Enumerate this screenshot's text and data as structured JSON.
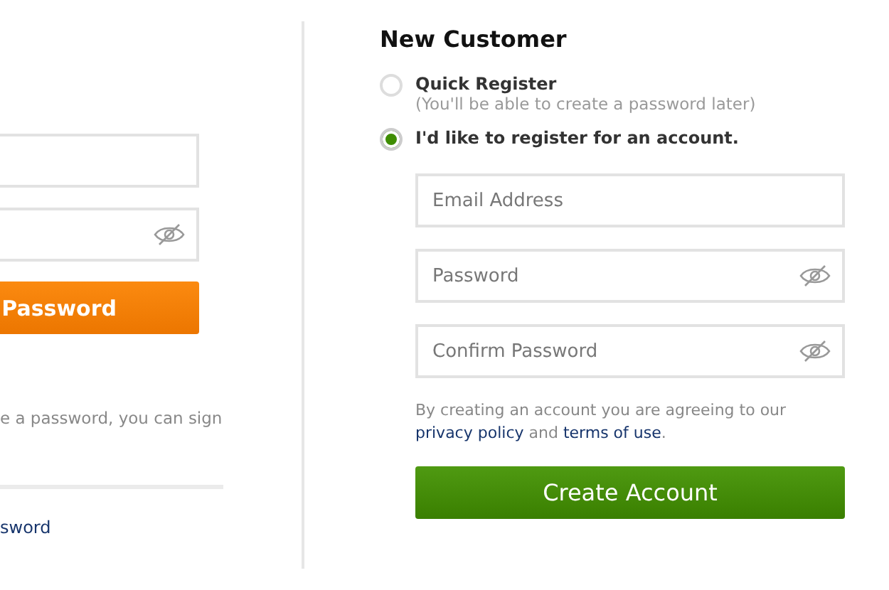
{
  "left_panel": {
    "fields": [
      {
        "kind": "text"
      },
      {
        "kind": "password"
      }
    ],
    "button": "Password",
    "note": "e a password, you can sign",
    "link": "sword"
  },
  "new_customer": {
    "title": "New Customer",
    "options": [
      {
        "label": "Quick Register",
        "hint": "(You'll be able to create a password later)",
        "selected": false
      },
      {
        "label": "I'd like to register for an account.",
        "selected": true
      }
    ],
    "fields": [
      {
        "placeholder": "Email Address",
        "kind": "text"
      },
      {
        "placeholder": "Password",
        "kind": "password"
      },
      {
        "placeholder": "Confirm Password",
        "kind": "password"
      }
    ],
    "terms": {
      "before": "By creating an account you are agreeing to our ",
      "link1": "privacy policy",
      "middle": " and ",
      "link2": "terms of use",
      "after": "."
    },
    "button": "Create Account"
  }
}
